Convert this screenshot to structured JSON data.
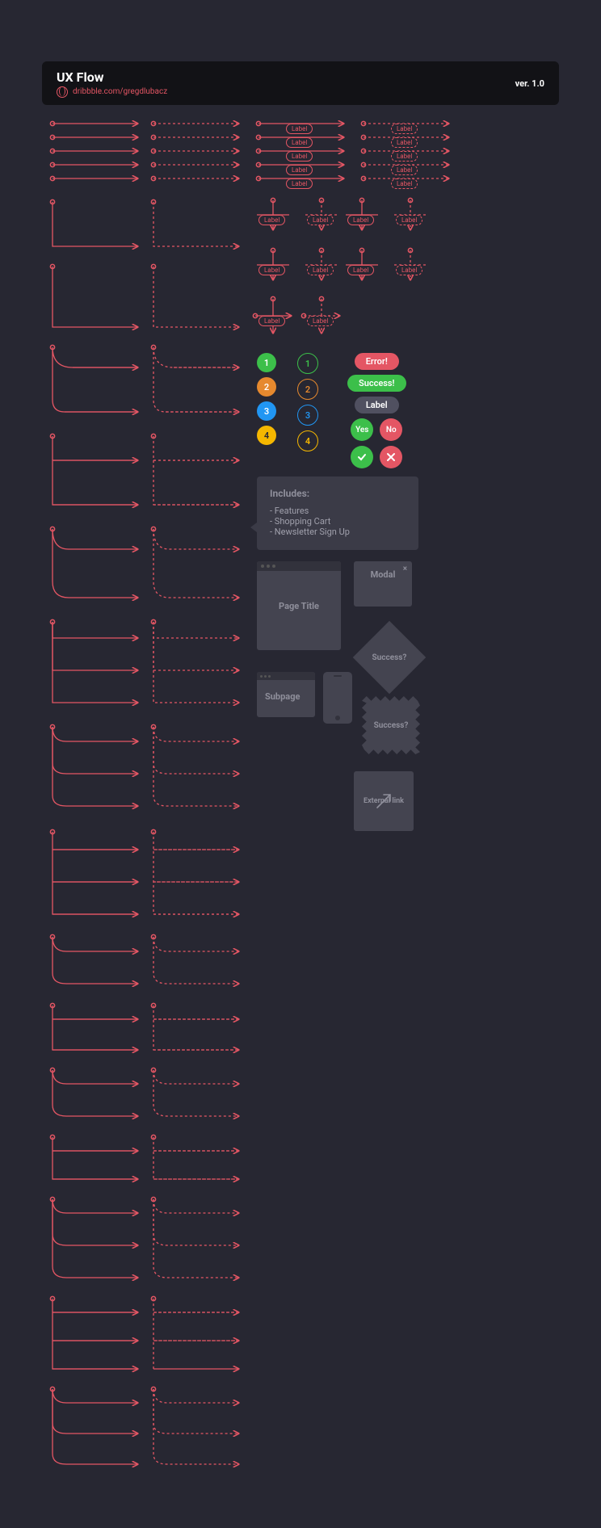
{
  "header": {
    "title": "UX Flow",
    "link": "dribbble.com/gregdlubacz",
    "version": "ver. 1.0"
  },
  "connector_label": "Label",
  "badges": {
    "filled": [
      "1",
      "2",
      "3",
      "4"
    ],
    "outlined": [
      "1",
      "2",
      "3",
      "4"
    ]
  },
  "pills": {
    "error": "Error!",
    "success": "Success!",
    "label": "Label",
    "yes": "Yes",
    "no": "No"
  },
  "includes": {
    "title": "Includes:",
    "items": [
      "Features",
      "Shopping Cart",
      "Newsletter Sign Up"
    ]
  },
  "elements": {
    "page": "Page Title",
    "modal": "Modal",
    "subpage": "Subpage",
    "success_q": "Success?",
    "external": "External link"
  },
  "colors": {
    "stroke": "#e45664",
    "bg": "#272732",
    "card": "#3b3b47",
    "panel": "#444450"
  }
}
